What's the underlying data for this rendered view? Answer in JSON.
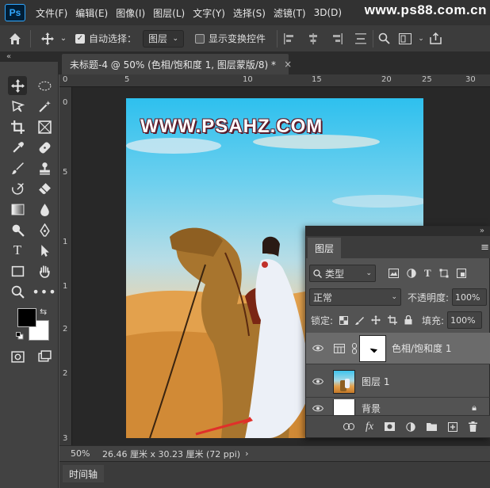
{
  "app": {
    "logo": "Ps",
    "watermark": "www.ps88.com.cn"
  },
  "menu": [
    "文件(F)",
    "编辑(E)",
    "图像(I)",
    "图层(L)",
    "文字(Y)",
    "选择(S)",
    "滤镜(T)",
    "3D(D)"
  ],
  "options": {
    "auto_select_label": "自动选择：",
    "auto_select_target": "图层",
    "show_transform_label": "显示变换控件"
  },
  "document": {
    "tab_title": "未标题-4 @ 50% (色相/饱和度 1, 图层蒙版/8) *",
    "close_glyph": "×",
    "image_text": "WWW.PSAHZ.COM"
  },
  "rulers": {
    "top": [
      "0",
      "5",
      "10",
      "15",
      "20",
      "25",
      "30"
    ],
    "left": [
      "0",
      "5",
      "1",
      "1",
      "2",
      "2",
      "3"
    ]
  },
  "status": {
    "zoom": "50%",
    "dimensions": "26.46 厘米 x 30.23 厘米 (72 ppi)",
    "arrow": "›"
  },
  "timeline": {
    "label": "时间轴"
  },
  "layers_panel": {
    "tab": "图层",
    "filter_kind": "类型",
    "blend_mode": "正常",
    "opacity_label": "不透明度:",
    "opacity_value": "100%",
    "lock_label": "锁定:",
    "fill_label": "填充:",
    "fill_value": "100%",
    "layers": [
      {
        "name": "色相/饱和度 1",
        "type": "adjustment",
        "selected": true
      },
      {
        "name": "图层 1",
        "type": "image",
        "selected": false
      },
      {
        "name": "背景",
        "type": "background",
        "selected": false
      }
    ]
  },
  "colors": {
    "accent": "#31a8ff",
    "foreground": "#000000",
    "background": "#ffffff"
  }
}
